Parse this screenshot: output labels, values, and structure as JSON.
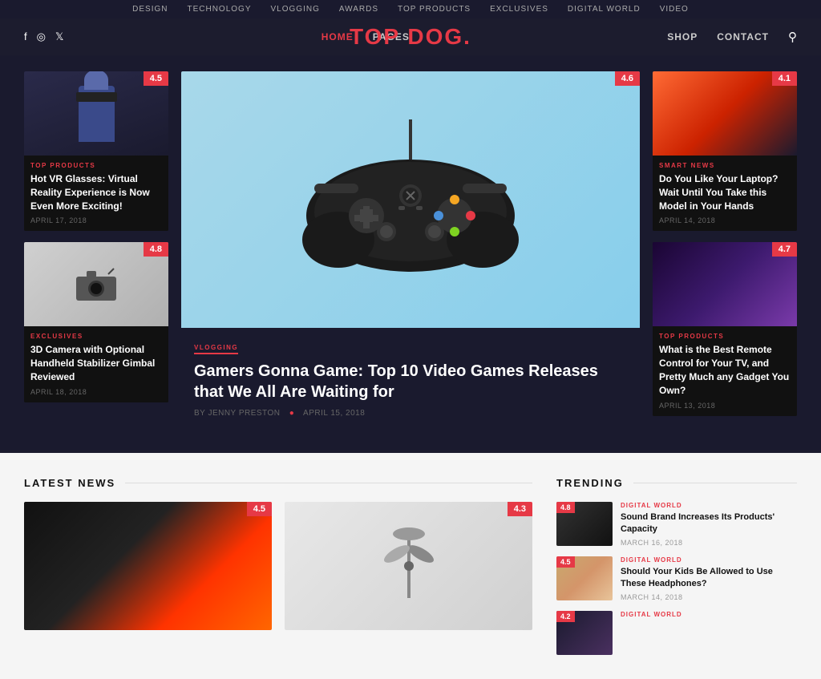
{
  "topbar": {
    "nav": [
      "Design",
      "Technology",
      "Vlogging",
      "Awards",
      "Top Products",
      "Exclusives",
      "Digital World",
      "Video"
    ]
  },
  "header": {
    "logo": "TOP DOG",
    "logo_dot": ".",
    "social": [
      "f",
      "◎",
      "🐦"
    ],
    "left_nav": [
      {
        "label": "Home",
        "active": true
      },
      {
        "label": "Pages",
        "active": false
      }
    ],
    "right_nav": [
      {
        "label": "Shop"
      },
      {
        "label": "Contact"
      }
    ]
  },
  "hero": {
    "left_cards": [
      {
        "category": "Top Products",
        "title": "Hot VR Glasses: Virtual Reality Experience is Now Even More Exciting!",
        "date": "April 17, 2018",
        "rating": "4.5"
      },
      {
        "category": "Exclusives",
        "title": "3D Camera with Optional Handheld Stabilizer Gimbal Reviewed",
        "date": "April 18, 2018",
        "rating": "4.8"
      }
    ],
    "featured": {
      "category": "Vlogging",
      "title": "Gamers Gonna Game: Top 10 Video Games Releases that We All Are Waiting for",
      "author": "By Jenny Preston",
      "date": "April 15, 2018",
      "rating": "4.6"
    },
    "right_cards": [
      {
        "category": "Smart News",
        "title": "Do You Like Your Laptop? Wait Until You Take this Model in Your Hands",
        "date": "April 14, 2018",
        "rating": "4.1"
      },
      {
        "category": "Top Products",
        "title": "What is the Best Remote Control for Your TV, and Pretty Much any Gadget You Own?",
        "date": "April 13, 2018",
        "rating": "4.7"
      }
    ]
  },
  "latest_news": {
    "section_title": "Latest News",
    "cards": [
      {
        "rating": "4.5"
      },
      {
        "rating": "4.3"
      }
    ]
  },
  "trending": {
    "section_title": "Trending",
    "items": [
      {
        "category": "Digital World",
        "title": "Sound Brand Increases Its Products' Capacity",
        "date": "March 16, 2018",
        "rating": "4.8"
      },
      {
        "category": "Digital World",
        "title": "Should Your Kids Be Allowed to Use These Headphones?",
        "date": "March 14, 2018",
        "rating": "4.5"
      },
      {
        "category": "Digital World",
        "title": "",
        "date": "",
        "rating": "4.2"
      }
    ]
  }
}
